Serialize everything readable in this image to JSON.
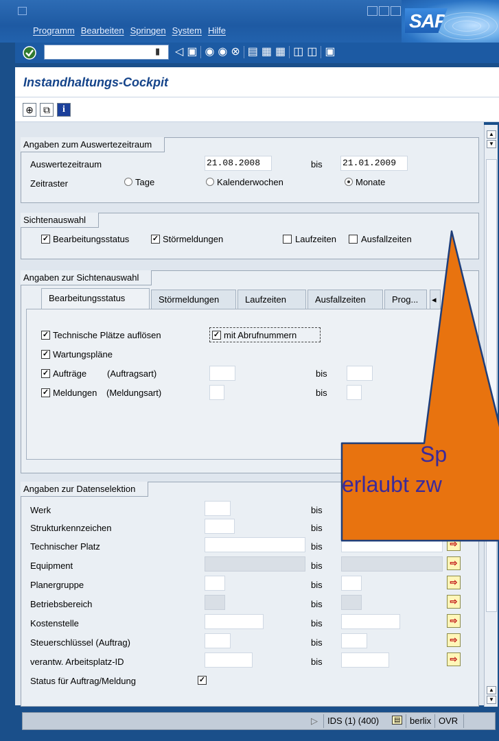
{
  "window": {
    "menu": [
      "Programm",
      "Bearbeiten",
      "Springen",
      "System",
      "Hilfe"
    ],
    "logo_text": "SAP",
    "icons": [
      "enter-icon",
      "save-icon",
      "back-icon",
      "exit-icon",
      "cancel-icon",
      "print-icon",
      "find-icon",
      "find-next-icon",
      "first-page-icon",
      "last-page-icon",
      "new-session-icon"
    ]
  },
  "screen": {
    "title": "Instandhaltungs-Cockpit",
    "app_icons": [
      "execute-icon",
      "get-variant-icon",
      "info-icon"
    ]
  },
  "period": {
    "group_title": "Angaben zum Auswertezeitraum",
    "label": "Auswertezeitraum",
    "from": "21.08.2008",
    "bis": "bis",
    "to": "21.01.2009",
    "raster_label": "Zeitraster",
    "options": [
      "Tage",
      "Kalenderwochen",
      "Monate"
    ],
    "selected": "Monate"
  },
  "views": {
    "group_title": "Sichtenauswahl",
    "items": [
      {
        "label": "Bearbeitungsstatus",
        "checked": true
      },
      {
        "label": "Störmeldungen",
        "checked": true
      },
      {
        "label": "Laufzeiten",
        "checked": false
      },
      {
        "label": "Ausfallzeiten",
        "checked": false
      }
    ]
  },
  "view_details": {
    "group_title": "Angaben zur Sichtenauswahl",
    "tabs": [
      "Bearbeitungsstatus",
      "Störmeldungen",
      "Laufzeiten",
      "Ausfallzeiten",
      "Prog..."
    ],
    "active_tab": "Bearbeitungsstatus",
    "rows": {
      "tp": "Technische Plätze auflösen",
      "wp": "Wartungspläne",
      "abruf": "mit Abrufnummern",
      "auftraege": "Aufträge",
      "auftragsart": "(Auftragsart)",
      "meldungen": "Meldungen",
      "meldungsart": "(Meldungsart)",
      "bis": "bis"
    }
  },
  "selection": {
    "group_title": "Angaben zur Datenselektion",
    "bis": "bis",
    "rows": [
      "Werk",
      "Strukturkennzeichen",
      "Technischer Platz",
      "Equipment",
      "Planergruppe",
      "Betriebsbereich",
      "Kostenstelle",
      "Steuerschlüssel (Auftrag)",
      "verantw. Arbeitsplatz-ID"
    ],
    "status_label": "Status für Auftrag/Meldung"
  },
  "status": {
    "system": "IDS (1) (400)",
    "server": "berlix",
    "mode": "OVR"
  },
  "callout": {
    "line1": "Sp",
    "line2": "erlaubt zw",
    "color": "#e8730f"
  }
}
